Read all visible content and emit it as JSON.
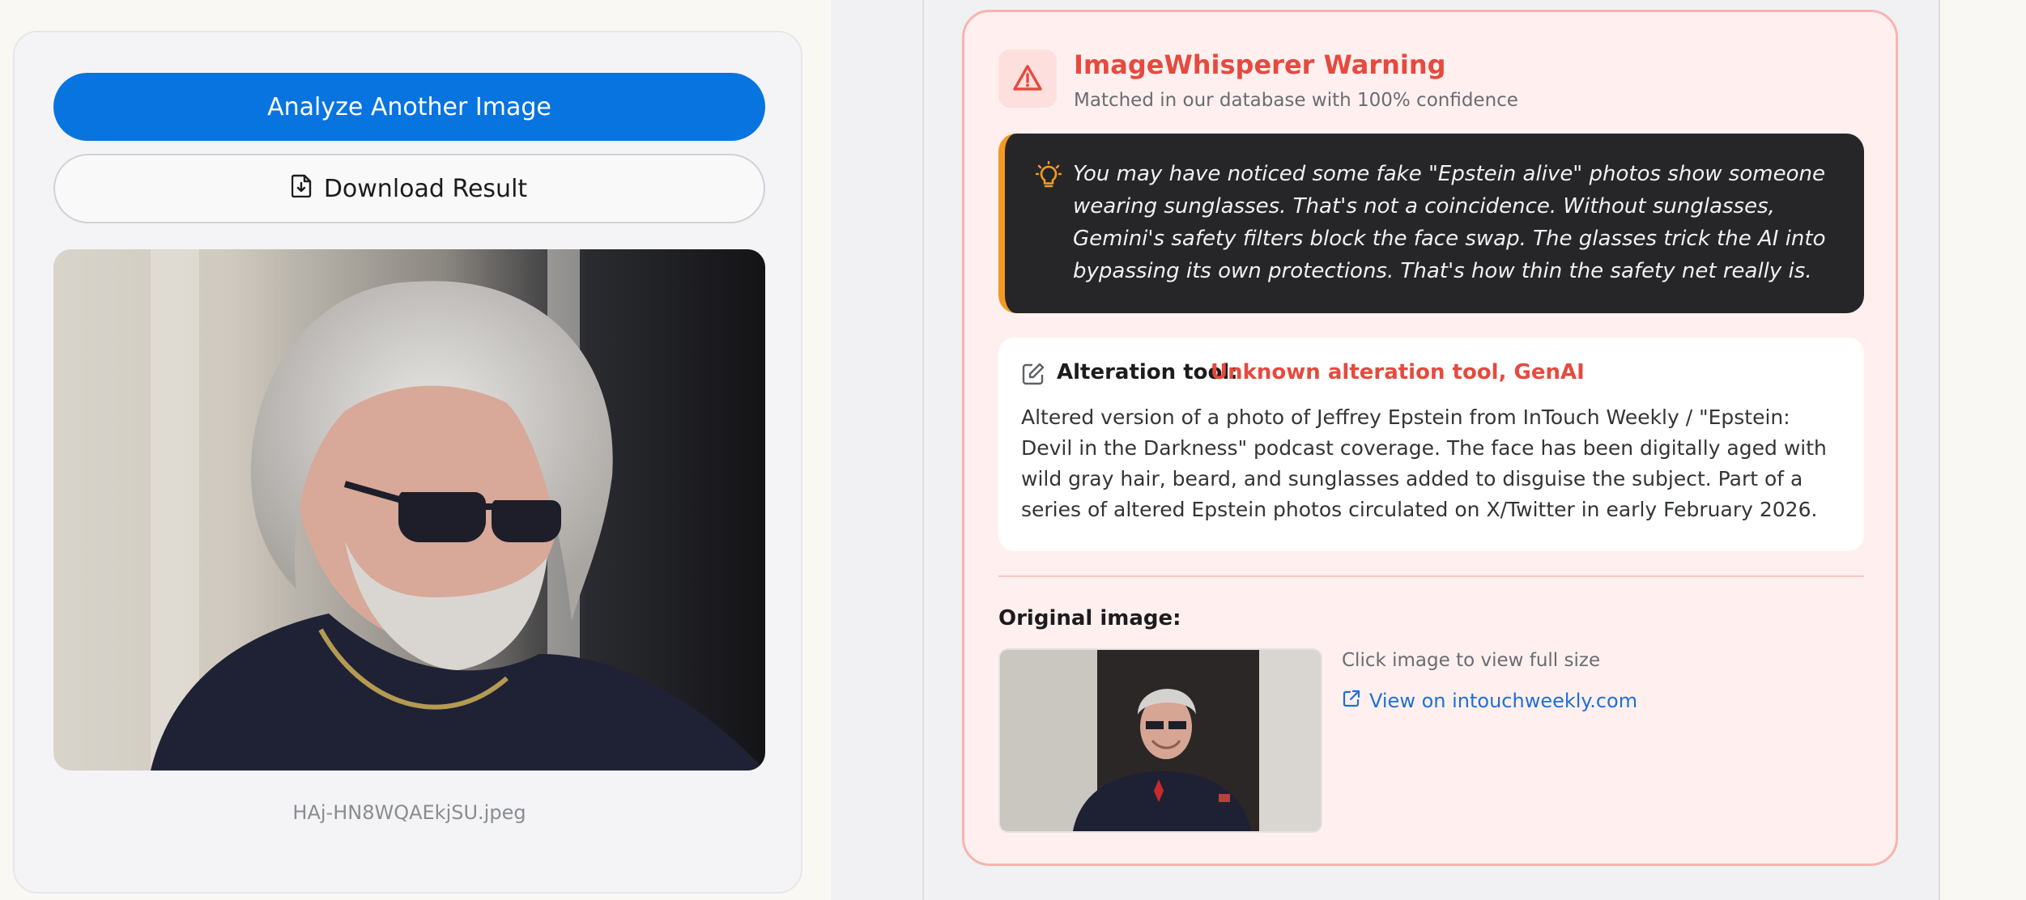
{
  "actions": {
    "analyze_label": "Analyze Another Image",
    "download_label": "Download Result"
  },
  "image": {
    "filename": "HAj-HN8WQAEkjSU.jpeg"
  },
  "warning": {
    "title": "ImageWhisperer Warning",
    "subtitle": "Matched in our database with 100% confidence",
    "tip": "You may have noticed some fake \"Epstein alive\" photos show someone wearing sunglasses. That's not a coincidence. Without sunglasses, Gemini's safety filters block the face swap. The glasses trick the AI into bypassing its own protections. That's how thin the safety net really is.",
    "alteration_label": "Alteration tool:",
    "alteration_value": "Unknown alteration tool, GenAI",
    "description": "Altered version of a photo of Jeffrey Epstein from InTouch Weekly / \"Epstein: Devil in the Darkness\" podcast coverage. The face has been digitally aged with wild gray hair, beard, and sunglasses added to disguise the subject. Part of a series of altered Epstein photos circulated on X/Twitter in early February 2026.",
    "original_label": "Original image:",
    "thumb_hint": "Click image to view full size",
    "view_link": "View on intouchweekly.com"
  },
  "colors": {
    "primary": "#0874e0",
    "warning": "#e64a3f",
    "tip_accent": "#f39a22",
    "link": "#1f6fd6"
  },
  "icons": [
    "file-download-icon",
    "warning-triangle-icon",
    "lightbulb-icon",
    "edit-icon",
    "external-link-icon"
  ]
}
